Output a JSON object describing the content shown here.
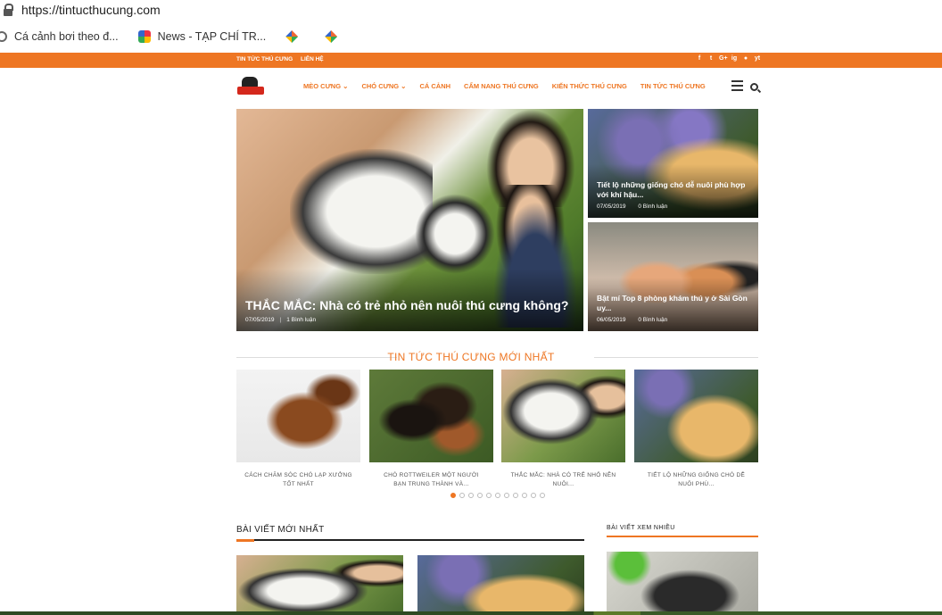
{
  "browser": {
    "url": "https://tintucthucung.com",
    "bookmarks": [
      {
        "label": "Cá cảnh bơi theo đ...",
        "icon": "tab-icon"
      },
      {
        "label": "News - TẠP CHÍ TR...",
        "icon": "news-icon"
      },
      {
        "label": "",
        "icon": "pinwheel-icon"
      },
      {
        "label": "",
        "icon": "pinwheel-icon"
      }
    ]
  },
  "topbar": {
    "links": [
      "TIN TỨC THÚ CƯNG",
      "LIÊN HỆ"
    ],
    "social": [
      "f",
      "t",
      "G+",
      "ig",
      "●",
      "yt"
    ]
  },
  "nav": {
    "items": [
      "MÈO CƯNG ⌄",
      "CHÓ CƯNG ⌄",
      "CÁ CẢNH",
      "CẨM NANG THÚ CƯNG",
      "KIẾN THỨC THÚ CƯNG",
      "TIN TỨC THÚ CƯNG"
    ]
  },
  "featured": {
    "main": {
      "title": "THẮC MẮC: Nhà có trẻ nhỏ nên nuôi thú cưng không?",
      "date": "07/05/2019",
      "comments": "1 Bình luận"
    },
    "side": [
      {
        "title": "Tiết lộ những giống chó dễ nuôi phù hợp với khí hậu...",
        "date": "07/05/2019",
        "comments": "0 Bình luận"
      },
      {
        "title": "Bật mí Top 8 phòng khám thú y ở Sài Gòn uy...",
        "date": "06/05/2019",
        "comments": "0 Bình luận"
      }
    ]
  },
  "latest_news": {
    "heading": "TIN TỨC THÚ CƯNG MỚI NHẤT",
    "cards": [
      "CÁCH CHĂM SÓC CHÓ LẠP XƯỞNG TỐT NHẤT",
      "CHÓ ROTTWEILER MỘT NGƯỜI BẠN TRUNG THÀNH VÀ...",
      "THẮC MẮC: NHÀ CÓ TRẺ NHỎ NÊN NUÔI...",
      "TIẾT LỘ NHỮNG GIỐNG CHÓ DỄ NUÔI PHÙ..."
    ],
    "dots": 11,
    "active_dot": 0
  },
  "sections": {
    "newest": "BÀI VIẾT MỚI NHẤT",
    "popular": "BÀI VIẾT XEM NHIỀU"
  },
  "colors": {
    "accent": "#ee7623"
  }
}
